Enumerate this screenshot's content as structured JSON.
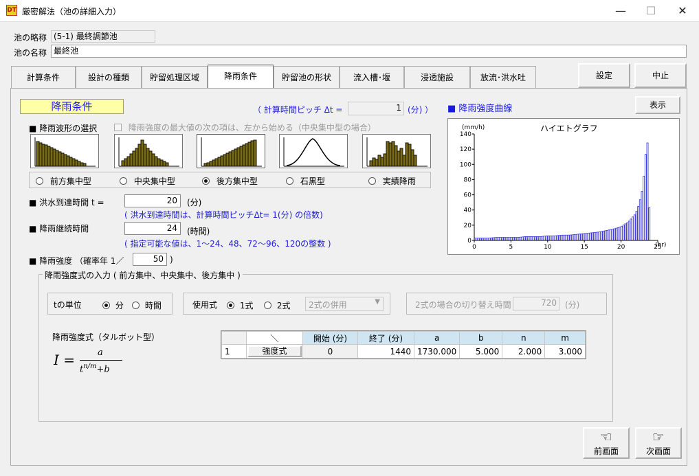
{
  "window": {
    "title": "厳密解法（池の詳細入力）",
    "icon_text": "DT",
    "controls": [
      "—",
      "☐",
      "✕"
    ]
  },
  "pond": {
    "short_name_label": "池の略称",
    "short_name_value": "(5-1) 最終調節池",
    "name_label": "池の名称",
    "name_value": "最終池"
  },
  "tabs": [
    "計算条件",
    "設計の種類",
    "貯留処理区域",
    "降雨条件",
    "貯留池の形状",
    "流入槽･堰",
    "浸透施設",
    "放流･洪水吐"
  ],
  "active_tab": 3,
  "top_buttons": {
    "settings": "設定",
    "cancel": "中止"
  },
  "section_title": "降雨条件",
  "pitch": {
    "label": "（ 計算時間ピッチ Δt =",
    "value": "1",
    "unit": "(分) ）"
  },
  "waveform": {
    "label": "■ 降雨波形の選択",
    "checkbox_label": "降雨強度の最大値の次の項は、左から始める（中央集中型の場合）",
    "options": [
      "前方集中型",
      "中央集中型",
      "後方集中型",
      "石黒型",
      "実績降雨"
    ],
    "selected": 2
  },
  "flood_time": {
    "label": "■ 洪水到達時間 t =",
    "value": "20",
    "unit": "(分)",
    "note": "( 洪水到達時間は、計算時間ピッチΔt= 1(分) の倍数)"
  },
  "duration": {
    "label": "■ 降雨継続時間",
    "value": "24",
    "unit": "(時間)",
    "note": "( 指定可能な値は、1～24、48、72～96、120の整数 )"
  },
  "intensity": {
    "label": "■ 降雨強度 （確率年 1／",
    "value": "50",
    "close": ")"
  },
  "formula_group": {
    "title": "降雨強度式の入力 ( 前方集中、中央集中、後方集中 )",
    "t_unit": {
      "label": "tの単位",
      "options": [
        "分",
        "時間"
      ],
      "selected": 0
    },
    "usage": {
      "label": "使用式",
      "options": [
        "1式",
        "2式"
      ],
      "selected": 0,
      "combo_value": "2式の併用"
    },
    "switch": {
      "label": "2式の場合の切り替え時間",
      "value": "720",
      "unit": "(分)"
    },
    "formula_title": "降雨強度式（タルボット型）",
    "formula": {
      "lhs": "I =",
      "num": "a",
      "den_base": "t",
      "den_exp": "n/m",
      "den_add": "+b"
    }
  },
  "table": {
    "headers": [
      "＼",
      "開始 (分)",
      "終了 (分)",
      "a",
      "b",
      "n",
      "m"
    ],
    "rows": [
      {
        "no": "1",
        "button": "強度式",
        "cells": [
          "0",
          "1440",
          "1730.000",
          "5.000",
          "2.000",
          "3.000"
        ]
      }
    ]
  },
  "graph_panel": {
    "label": "■ 降雨強度曲線",
    "show_button": "表示",
    "title": "ハイエトグラフ",
    "y_unit": "(mm/h)",
    "x_unit": "(hr)",
    "y_ticks": [
      "140",
      "120",
      "100",
      "80",
      "60",
      "40",
      "20",
      "0"
    ],
    "x_ticks": [
      "0",
      "5",
      "10",
      "15",
      "20",
      "25"
    ]
  },
  "chart_data": {
    "type": "bar",
    "title": "ハイエトグラフ",
    "xlabel": "(hr)",
    "ylabel": "(mm/h)",
    "xlim": [
      0,
      25
    ],
    "ylim": [
      0,
      140
    ],
    "bar_color": "#3b3bdc",
    "note_values": "hourly-ish intensity, back-loaded (後方集中型), peak ~138 mm/h near 23.7 hr",
    "x": [
      0,
      1,
      2,
      3,
      4,
      5,
      6,
      7,
      8,
      9,
      10,
      11,
      12,
      13,
      14,
      15,
      16,
      17,
      18,
      19,
      20,
      21,
      22,
      22.5,
      23,
      23.3,
      23.6,
      23.8,
      24
    ],
    "values": [
      3,
      3,
      3,
      4,
      4,
      4,
      4,
      5,
      5,
      5,
      6,
      6,
      7,
      7,
      8,
      9,
      10,
      11,
      13,
      15,
      18,
      24,
      35,
      48,
      70,
      105,
      138,
      60,
      15
    ]
  },
  "nav": {
    "prev": "前画面",
    "next": "次画面"
  },
  "colors": {
    "accent_blue": "#2020d8",
    "label_yellow": "#ffffa8",
    "header_blue": "#cfe6f2",
    "olive": "#7a6a10"
  }
}
